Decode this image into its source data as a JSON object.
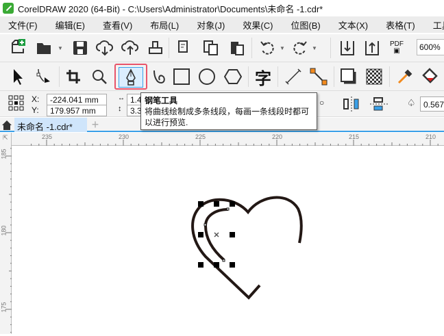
{
  "title": "CorelDRAW 2020 (64-Bit) - C:\\Users\\Administrator\\Documents\\未命名 -1.cdr*",
  "menu": [
    "文件(F)",
    "编辑(E)",
    "查看(V)",
    "布局(L)",
    "对象(J)",
    "效果(C)",
    "位图(B)",
    "文本(X)",
    "表格(T)",
    "工具(O)"
  ],
  "toolbar": {
    "zoom": "600%",
    "pdf": "PDF"
  },
  "toolbox": {
    "text_tool": "字"
  },
  "props": {
    "x_label": "X:",
    "y_label": "Y:",
    "x": "-224.041 mm",
    "y": "179.957 mm",
    "w": "1.4",
    "h": "3.3",
    "outline": "0.567"
  },
  "tooltip": {
    "title": "钢笔工具",
    "body": "将曲线绘制成多条线段，每画一条线段时都可以进行预览."
  },
  "tab": {
    "label": "未命名 -1.cdr*",
    "add": "+"
  },
  "ruler": {
    "h": [
      "235",
      "230",
      "225",
      "220",
      "215",
      "210"
    ],
    "v": [
      "185",
      "180",
      "175"
    ]
  },
  "colors": {
    "accent": "#3aa0e8",
    "highlight": "#e8546a",
    "stroke": "#231815"
  }
}
